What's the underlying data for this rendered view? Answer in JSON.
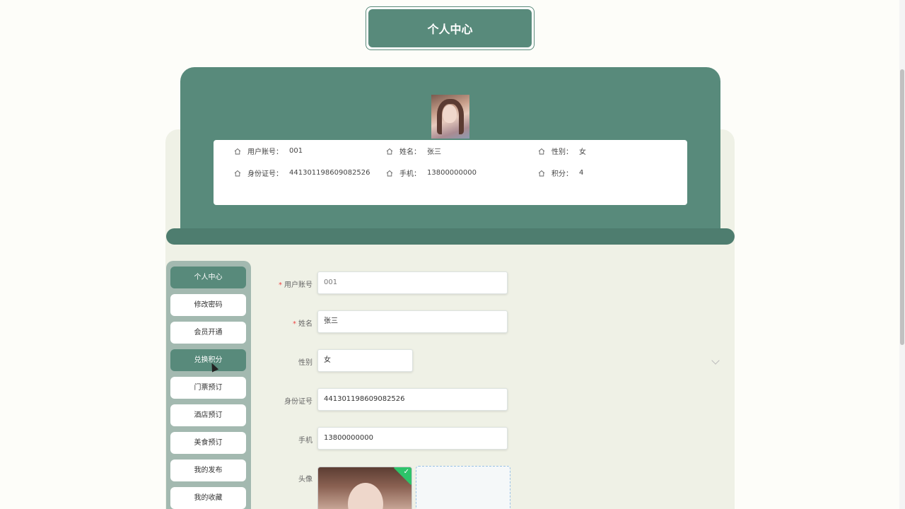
{
  "page_title": "个人中心",
  "profile": {
    "fields": [
      {
        "label": "用户账号：",
        "value": "001"
      },
      {
        "label": "姓名：",
        "value": "张三"
      },
      {
        "label": "性别：",
        "value": "女"
      },
      {
        "label": "身份证号：",
        "value": "441301198609082526"
      },
      {
        "label": "手机：",
        "value": "13800000000"
      },
      {
        "label": "积分：",
        "value": "4"
      }
    ]
  },
  "menu": {
    "items": [
      {
        "label": "个人中心",
        "active": true
      },
      {
        "label": "修改密码",
        "active": false
      },
      {
        "label": "会员开通",
        "active": false
      },
      {
        "label": "兑换积分",
        "active": true
      },
      {
        "label": "门票预订",
        "active": false
      },
      {
        "label": "酒店预订",
        "active": false
      },
      {
        "label": "美食预订",
        "active": false
      },
      {
        "label": "我的发布",
        "active": false
      },
      {
        "label": "我的收藏",
        "active": false
      }
    ]
  },
  "form": {
    "account": {
      "label": "用户账号",
      "required": "*",
      "value": "001"
    },
    "name": {
      "label": "姓名",
      "required": "*",
      "value": "张三"
    },
    "gender": {
      "label": "性别",
      "value": "女"
    },
    "id_card": {
      "label": "身份证号",
      "value": "441301198609082526"
    },
    "phone": {
      "label": "手机",
      "value": "13800000000"
    },
    "avatar": {
      "label": "头像"
    }
  },
  "colors": {
    "primary": "#588a7b",
    "panel": "#eff1e6",
    "menu_bg": "#a3b9b0",
    "success": "#2ec36a"
  },
  "icons": {
    "field_icon": "home-icon",
    "success_icon": "check-icon",
    "select_icon": "chevron-down-icon"
  }
}
